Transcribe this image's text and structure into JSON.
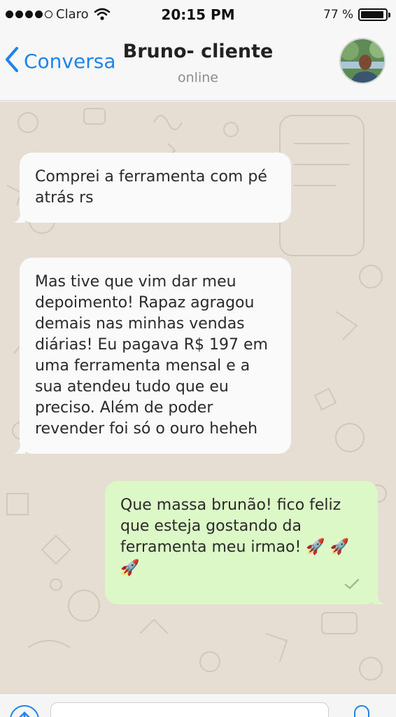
{
  "status_bar": {
    "carrier": "Claro",
    "time": "20:15 PM",
    "battery": "77 %",
    "battery_level": 0.77,
    "signal_bars_filled": 4,
    "signal_bars_total": 5
  },
  "header": {
    "back_label": "Conversa",
    "contact_name": "Bruno- cliente",
    "contact_status": "online"
  },
  "messages": [
    {
      "direction": "incoming",
      "text": "Comprei a ferramenta com pé atrás rs"
    },
    {
      "direction": "incoming",
      "text": "Mas tive que vim dar meu depoimento! Rapaz agragou demais nas minhas vendas diárias! Eu pagava R$ 197 em uma ferramenta mensal e a sua atendeu tudo que eu preciso. Além de poder revender foi só o ouro heheh"
    },
    {
      "direction": "outgoing",
      "text": "Que massa brunão! fico feliz que esteja gostando da ferramenta meu irmao! 🚀 🚀 🚀",
      "status": "sent"
    }
  ],
  "colors": {
    "accent": "#1e84ea",
    "chat_background": "#e7ded3",
    "incoming_bubble": "#fafafa",
    "outgoing_bubble": "#dcf8c6"
  },
  "icons": {
    "back": "chevron-left-icon",
    "wifi": "wifi-icon",
    "battery": "battery-icon",
    "sent_check": "check-icon",
    "upload": "upload-icon",
    "mic": "microphone-icon"
  }
}
